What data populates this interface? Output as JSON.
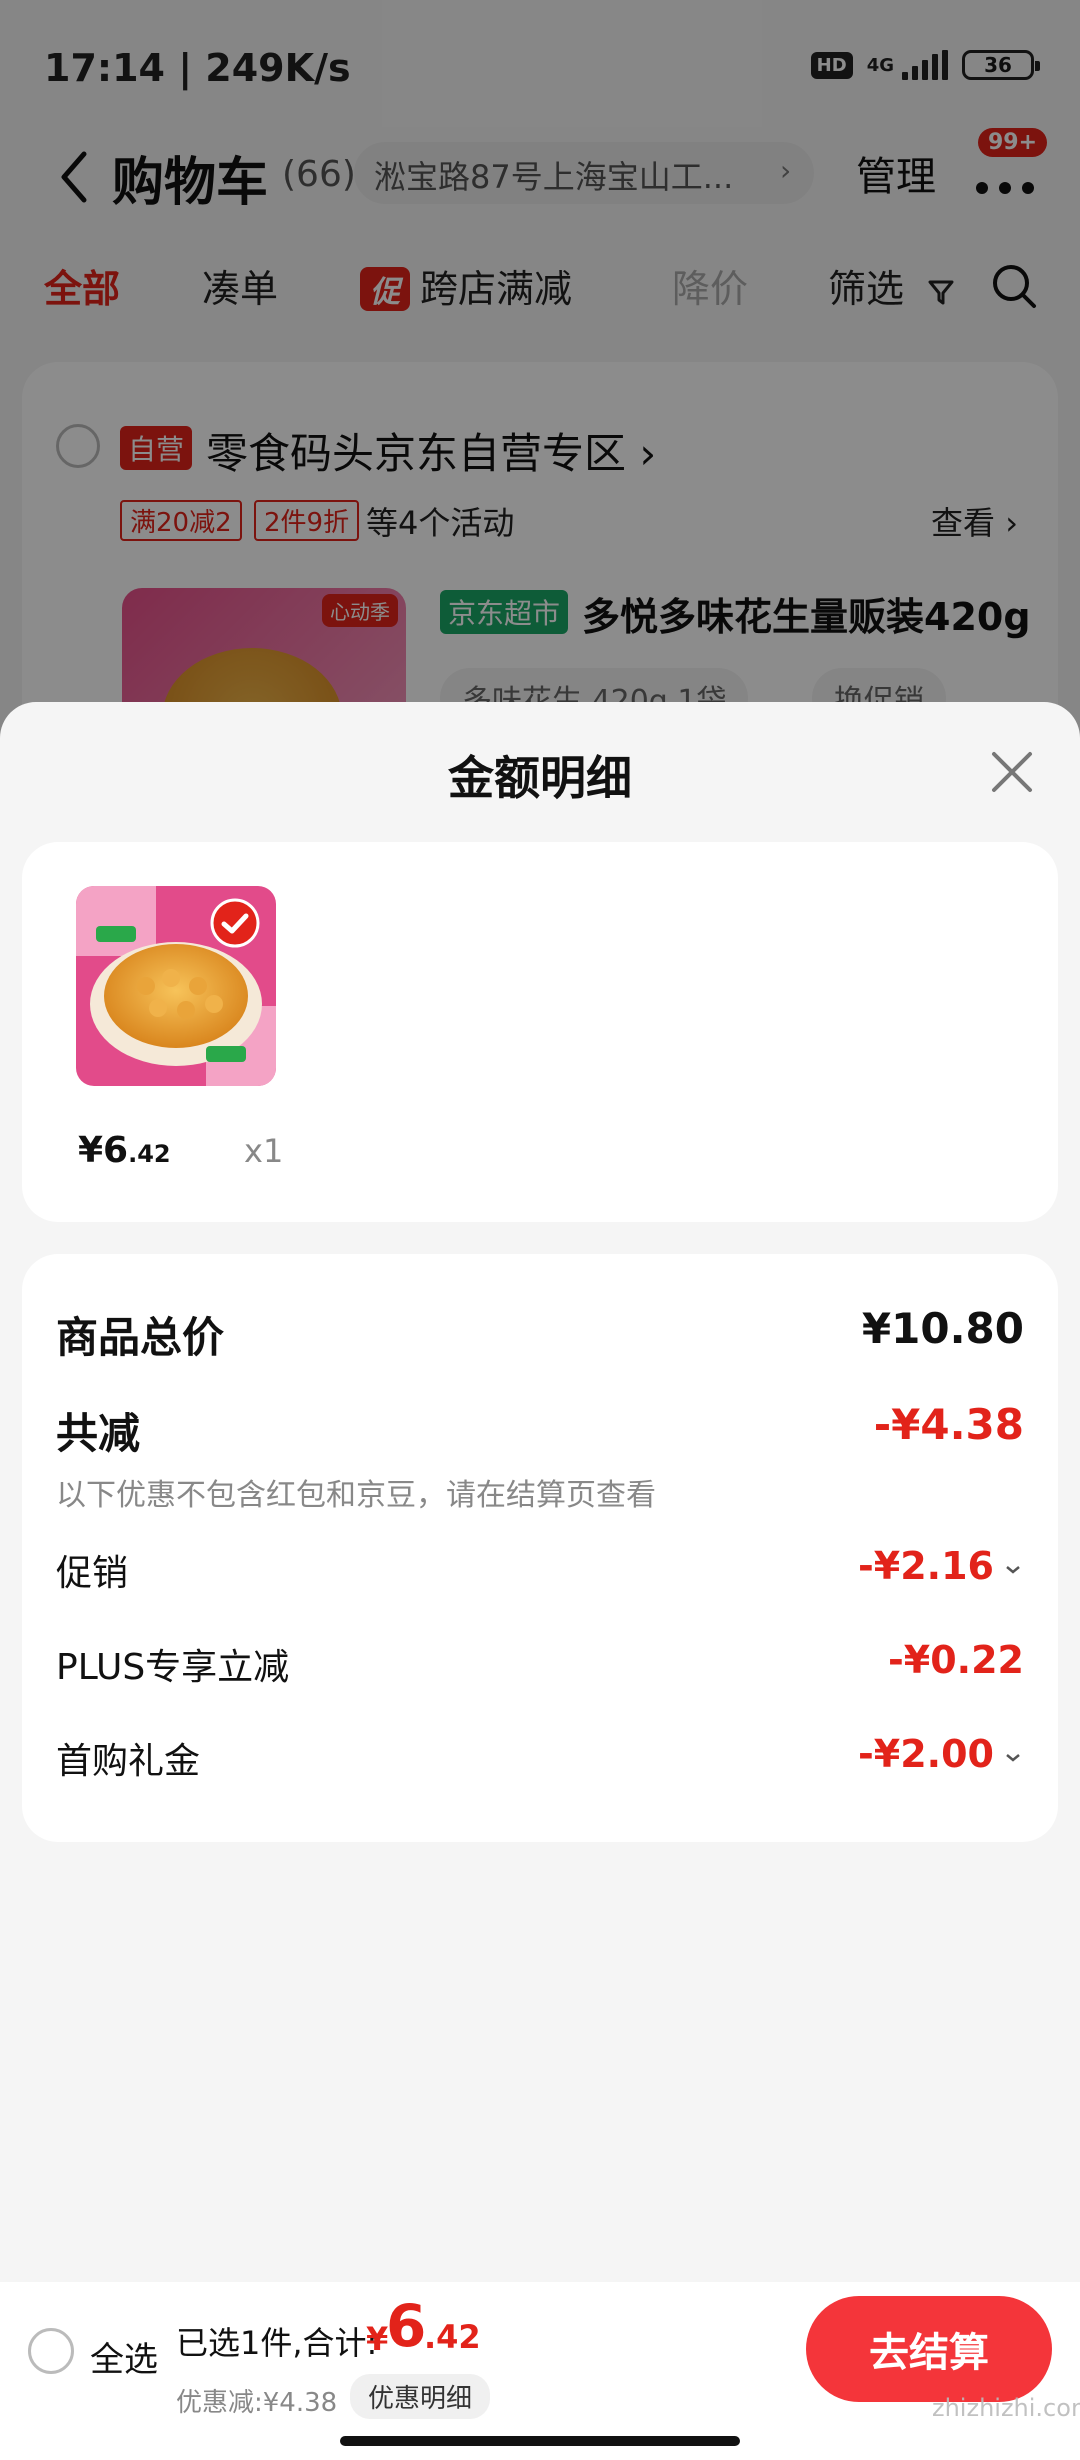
{
  "status_bar": {
    "time_speed": "17:14 | 249K/s",
    "hd": "HD",
    "network": "4G",
    "battery": "36"
  },
  "cart_header": {
    "title": "购物车",
    "count": "(66)",
    "address": "淞宝路87号上海宝山工...",
    "manage": "管理",
    "badge": "99+"
  },
  "tabs": [
    {
      "label": "全部",
      "state": "active"
    },
    {
      "label": "凑单",
      "state": "normal"
    },
    {
      "label": "跨店满减",
      "promo_tag": "促",
      "state": "normal"
    },
    {
      "label": "降价",
      "state": "muted"
    },
    {
      "label": "筛选",
      "state": "normal"
    }
  ],
  "store": {
    "self_tag": "自营",
    "name": "零食码头京东自营专区",
    "activities": [
      "满20减2",
      "2件9折"
    ],
    "activities_more": "等4个活动",
    "view": "查看",
    "product": {
      "badge": "心动季",
      "market_tag": "京东超市",
      "name": "多悦多味花生量贩装420g",
      "spec": "多味花生 420g 1袋",
      "promo": "换促销"
    }
  },
  "sheet": {
    "title": "金额明细",
    "items": [
      {
        "price_int": "¥6",
        "price_dec": ".42",
        "qty": "x1"
      }
    ],
    "summary": {
      "total_label": "商品总价",
      "total_value": "¥10.80",
      "reduce_label": "共减",
      "reduce_value": "-¥4.38",
      "note": "以下优惠不包含红包和京豆，请在结算页查看",
      "rows": [
        {
          "label": "促销",
          "value": "-¥2.16",
          "expandable": true
        },
        {
          "label": "PLUS专享立减",
          "value": "-¥0.22",
          "expandable": false
        },
        {
          "label": "首购礼金",
          "value": "-¥2.00",
          "expandable": true
        }
      ]
    }
  },
  "bottom_bar": {
    "select_all": "全选",
    "selected": "已选1件,合计:",
    "currency": "¥",
    "total_int": "6",
    "total_dec": ".42",
    "discount": "优惠减:¥4.38",
    "detail_chip": "优惠明细",
    "checkout": "去结算",
    "watermark": "zhizhizhi.com"
  },
  "colors": {
    "accent": "#e2231a",
    "checkout": "#f4353a",
    "market_green": "#1aa867"
  }
}
